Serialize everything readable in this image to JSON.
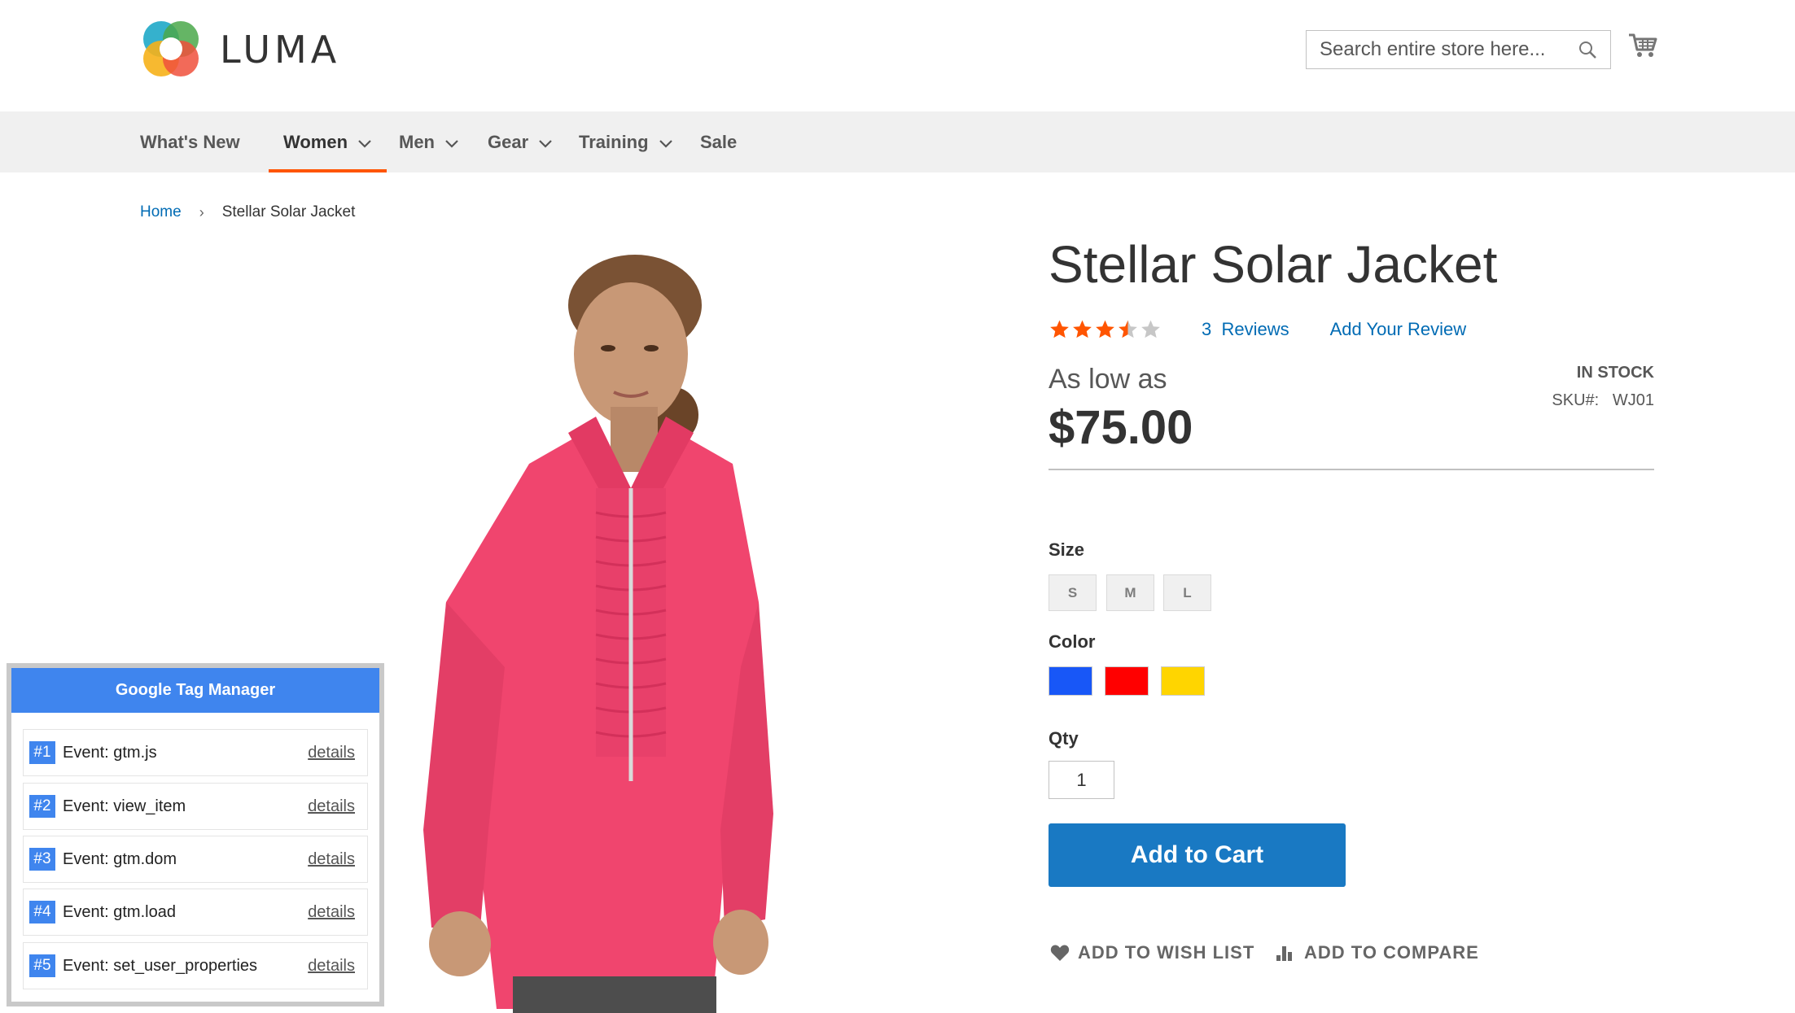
{
  "header": {
    "logo_text": "LUMA",
    "search_placeholder": "Search entire store here...",
    "icons": {
      "search": "search-icon",
      "cart": "cart-icon"
    }
  },
  "nav": {
    "items": [
      {
        "label": "What's New",
        "has_dropdown": false,
        "active": false
      },
      {
        "label": "Women",
        "has_dropdown": true,
        "active": true
      },
      {
        "label": "Men",
        "has_dropdown": true,
        "active": false
      },
      {
        "label": "Gear",
        "has_dropdown": true,
        "active": false
      },
      {
        "label": "Training",
        "has_dropdown": true,
        "active": false
      },
      {
        "label": "Sale",
        "has_dropdown": false,
        "active": false
      }
    ]
  },
  "breadcrumb": {
    "home": "Home",
    "separator": "›",
    "current": "Stellar Solar Jacket"
  },
  "product": {
    "title": "Stellar Solar Jacket",
    "rating": {
      "value": 3.5,
      "max": 5
    },
    "reviews_count": "3",
    "reviews_label": "Reviews",
    "add_review": "Add Your Review",
    "as_low_as": "As low as",
    "price": "$75.00",
    "stock": "IN STOCK",
    "sku_label": "SKU#:",
    "sku": "WJ01",
    "size_label": "Size",
    "sizes": [
      "S",
      "M",
      "L"
    ],
    "color_label": "Color",
    "colors": [
      "#1857f7",
      "#ff0000",
      "#ffd500"
    ],
    "qty_label": "Qty",
    "qty": "1",
    "add_to_cart": "Add to Cart",
    "wishlist": "ADD TO WISH LIST",
    "compare": "ADD TO COMPARE"
  },
  "gtm": {
    "title": "Google Tag Manager",
    "details_label": "details",
    "events": [
      {
        "badge": "#1",
        "text": "Event: gtm.js"
      },
      {
        "badge": "#2",
        "text": "Event: view_item"
      },
      {
        "badge": "#3",
        "text": "Event: gtm.dom"
      },
      {
        "badge": "#4",
        "text": "Event: gtm.load"
      },
      {
        "badge": "#5",
        "text": "Event: set_user_properties"
      }
    ]
  },
  "colors": {
    "accent": "#ff5501",
    "link": "#1979c3",
    "gtm_blue": "#3f85ee"
  }
}
